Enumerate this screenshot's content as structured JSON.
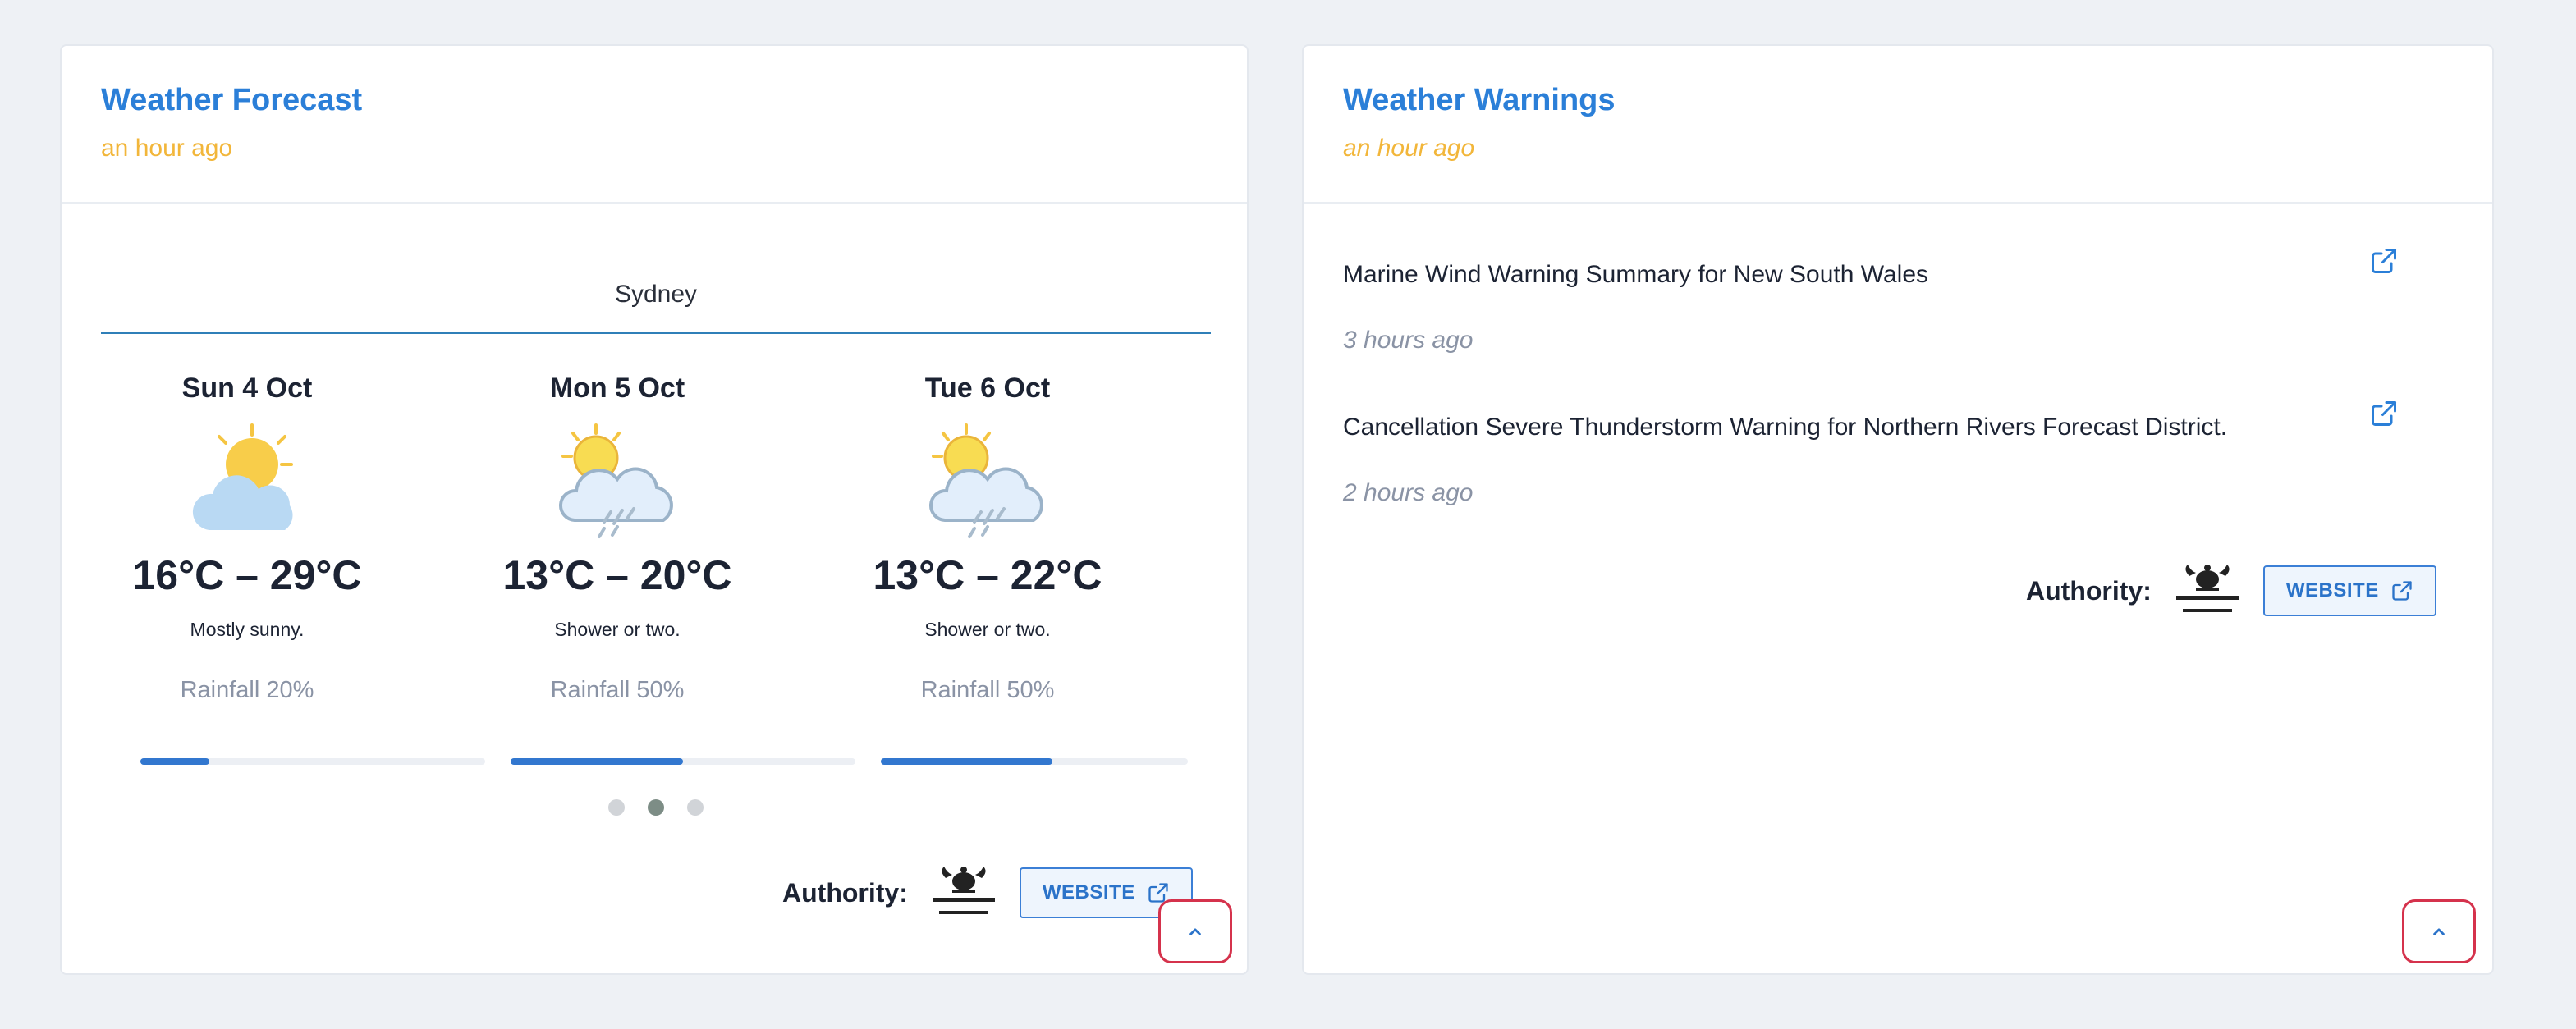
{
  "forecast": {
    "title": "Weather Forecast",
    "updated": "an hour ago",
    "location": "Sydney",
    "days": [
      {
        "date": "Sun 4 Oct",
        "icon": "mostly-sunny-icon",
        "temp": "16°C – 29°C",
        "summary": "Mostly sunny.",
        "rainfall_label": "Rainfall 20%",
        "rainfall_pct": 20
      },
      {
        "date": "Mon 5 Oct",
        "icon": "sun-cloud-rain-icon",
        "temp": "13°C – 20°C",
        "summary": "Shower or two.",
        "rainfall_label": "Rainfall 50%",
        "rainfall_pct": 50
      },
      {
        "date": "Tue 6 Oct",
        "icon": "sun-cloud-rain-icon",
        "temp": "13°C – 22°C",
        "summary": "Shower or two.",
        "rainfall_label": "Rainfall 50%",
        "rainfall_pct": 56
      }
    ],
    "carousel_active_index": 1,
    "authority_label": "Authority:",
    "website_label": "WEBSITE"
  },
  "warnings": {
    "title": "Weather Warnings",
    "updated": "an hour ago",
    "items": [
      {
        "title": "Marine Wind Warning Summary for New South Wales",
        "time": "3 hours ago"
      },
      {
        "title": "Cancellation Severe Thunderstorm Warning for Northern Rivers Forecast District.",
        "time": "2 hours ago"
      }
    ],
    "authority_label": "Authority:",
    "website_label": "WEBSITE"
  },
  "colors": {
    "accent": "#2b7fd8",
    "timestamp": "#f2b63a",
    "rain_bar": "#3277cf",
    "collapse_border": "#d5324c"
  }
}
